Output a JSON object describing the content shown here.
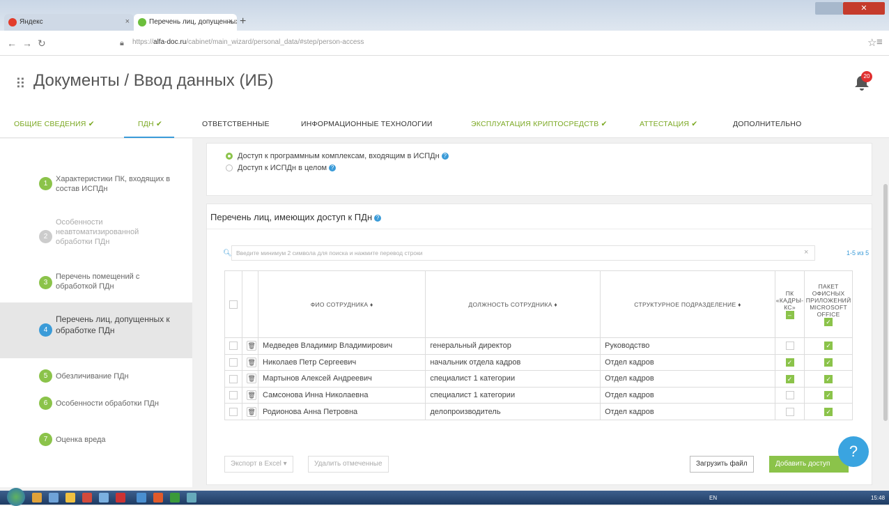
{
  "browser": {
    "tabs": [
      {
        "label": "Яндекс",
        "close": "×"
      },
      {
        "label": "Перечень лиц, допущенных",
        "close": "×"
      }
    ],
    "new_tab": "+",
    "url_prefix": "https://",
    "url_domain": "alfa-doc.ru",
    "url_path": "/cabinet/main_wizard/personal_data/#step/person-access"
  },
  "header": {
    "title": "Документы / Ввод данных (ИБ)",
    "notifications": "20"
  },
  "main_tabs": [
    {
      "label": "ОБЩИЕ СВЕДЕНИЯ ✔",
      "done": true
    },
    {
      "label": "ПДН ✔",
      "done": true
    },
    {
      "label": "ОТВЕТСТВЕННЫЕ",
      "done": false
    },
    {
      "label": "ИНФОРМАЦИОННЫЕ ТЕХНОЛОГИИ",
      "done": false
    },
    {
      "label": "ЭКСПЛУАТАЦИЯ КРИПТОСРЕДСТВ ✔",
      "done": true
    },
    {
      "label": "АТТЕСТАЦИЯ ✔",
      "done": true
    },
    {
      "label": "ДОПОЛНИТЕЛЬНО",
      "done": false
    }
  ],
  "sidebar": {
    "items": [
      {
        "num": "1",
        "label": "Характеристики ПК, входящих в состав ИСПДн"
      },
      {
        "num": "2",
        "label": "Особенности неавтоматизированной обработки ПДн"
      },
      {
        "num": "3",
        "label": "Перечень помещений с обработкой ПДн"
      },
      {
        "num": "4",
        "label": "Перечень лиц, допущенных к обработке ПДн"
      },
      {
        "num": "5",
        "label": "Обезличивание ПДн"
      },
      {
        "num": "6",
        "label": "Особенности обработки ПДн"
      },
      {
        "num": "7",
        "label": "Оценка вреда"
      }
    ]
  },
  "access": {
    "option1": "Доступ к программным комплексам, входящим в ИСПДн",
    "option2": "Доступ к ИСПДн в целом",
    "selected": 1
  },
  "list": {
    "title": "Перечень лиц, имеющих доступ к ПДн",
    "search_placeholder": "Введите минимум 2 символа для поиска и нажмите перевод строки",
    "count": "1-5 из 5",
    "columns": {
      "name": "ФИО СОТРУДНИКА ♦",
      "position": "ДОЛЖНОСТЬ СОТРУДНИКА ♦",
      "department": "СТРУКТУРНОЕ ПОДРАЗДЕЛЕНИЕ ♦",
      "pk": "ПК «КАДРЫ-КС»",
      "office": "ПАКЕТ ОФИСНЫХ ПРИЛОЖЕНИЙ MICROSOFT OFFICE"
    },
    "rows": [
      {
        "name": "Медведев Владимир Владимирович",
        "position": "генеральный директор",
        "department": "Руководство",
        "pk": false,
        "office": true
      },
      {
        "name": "Николаев Петр Сергеевич",
        "position": "начальник отдела кадров",
        "department": "Отдел кадров",
        "pk": true,
        "office": true
      },
      {
        "name": "Мартынов Алексей Андреевич",
        "position": "специалист 1 категории",
        "department": "Отдел кадров",
        "pk": true,
        "office": true
      },
      {
        "name": "Самсонова Инна Николаевна",
        "position": "специалист 1 категории",
        "department": "Отдел кадров",
        "pk": false,
        "office": true
      },
      {
        "name": "Родионова Анна Петровна",
        "position": "делопроизводитель",
        "department": "Отдел кадров",
        "pk": false,
        "office": true
      }
    ],
    "buttons": {
      "export": "Экспорт в Excel ▾",
      "delete": "Удалить отмеченные",
      "upload": "Загрузить файл",
      "add": "Добавить доступ"
    }
  },
  "help": "?",
  "taskbar": {
    "lang": "EN",
    "time": "15:48"
  },
  "colors": {
    "accent": "#3a9bd8",
    "done": "#8bc34a"
  }
}
